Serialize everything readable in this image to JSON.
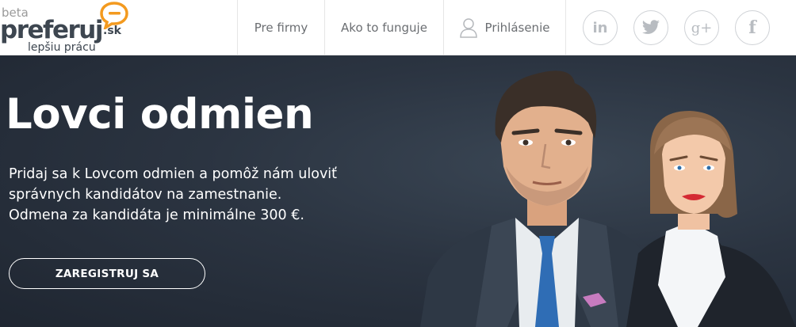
{
  "brand": {
    "beta": "beta",
    "name": "preferuj",
    "domain": ".sk",
    "tagline": "lepšiu prácu",
    "accent_color": "#f39a1f"
  },
  "nav": {
    "firms": "Pre firmy",
    "how": "Ako to funguje",
    "login": "Prihlásenie",
    "login_icon": "user-icon"
  },
  "social": {
    "linkedin": "in",
    "twitter_icon": "twitter-bird-icon",
    "googleplus": "g+",
    "facebook": "f"
  },
  "hero": {
    "title": "Lovci odmien",
    "lines": [
      "Pridaj sa k Lovcom odmien a pomôž nám uloviť",
      "správnych kandidátov na zamestnanie.",
      "Odmena za kandidáta je minimálne 300 €."
    ],
    "cta": "ZAREGISTRUJ SA",
    "background": "#2b3441"
  }
}
